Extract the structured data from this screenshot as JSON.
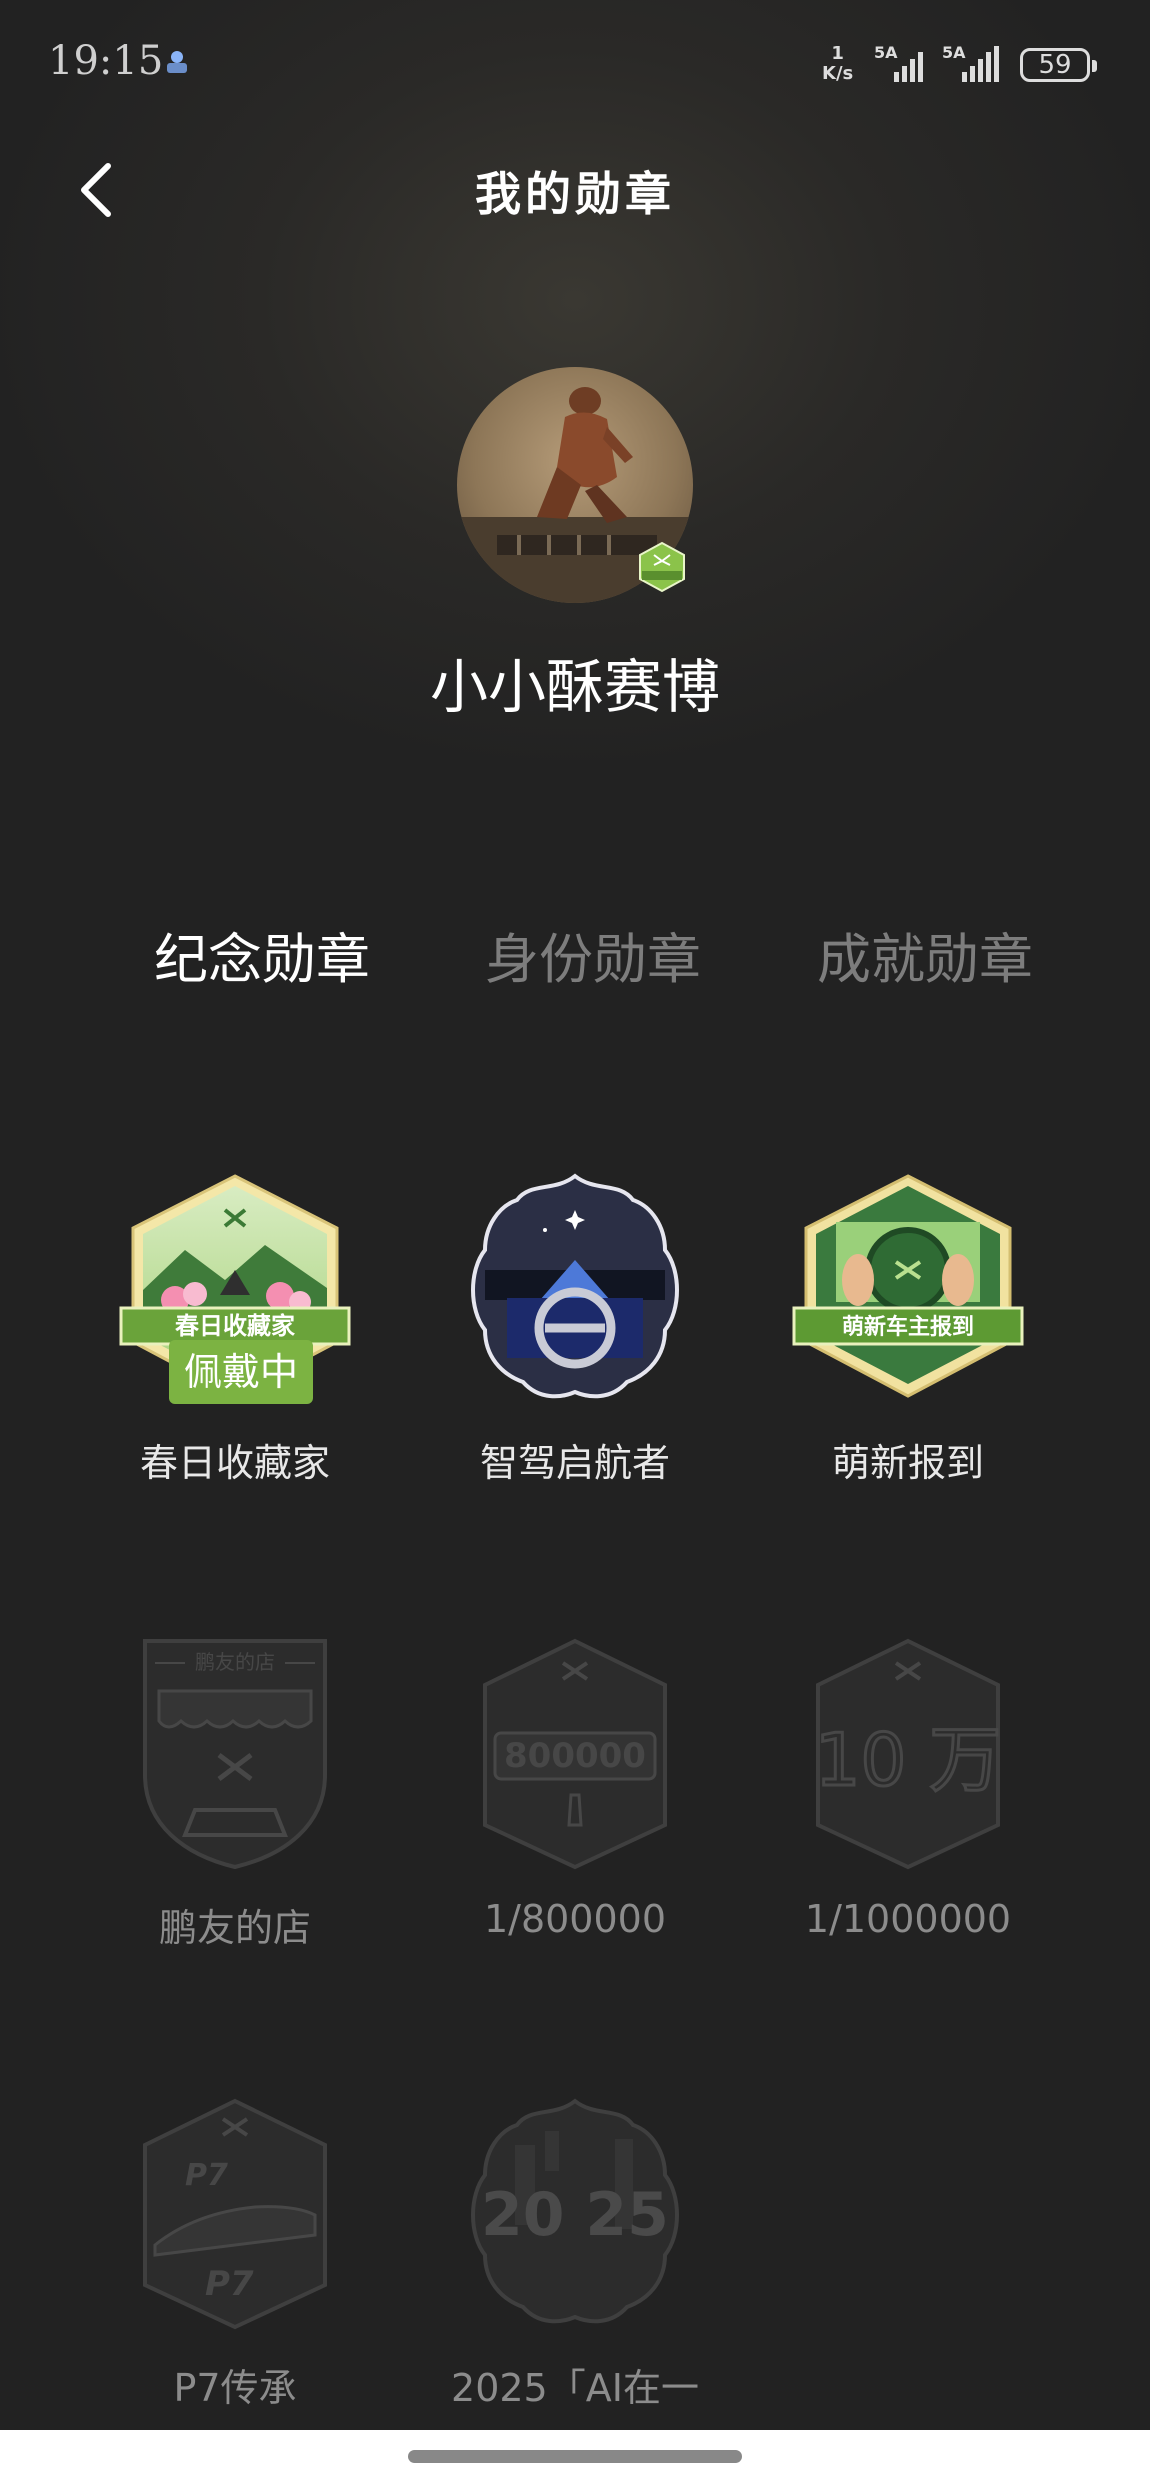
{
  "status_bar": {
    "time": "19:15",
    "net_speed_value": "1",
    "net_speed_unit": "K/s",
    "signal_1_label": "5A",
    "signal_2_label": "5A",
    "battery": "59"
  },
  "header": {
    "title": "我的勋章"
  },
  "profile": {
    "username": "小小酥赛博"
  },
  "tabs": [
    {
      "label": "纪念勋章",
      "active": true
    },
    {
      "label": "身份勋章",
      "active": false
    },
    {
      "label": "成就勋章",
      "active": false
    }
  ],
  "badges": [
    {
      "name": "春日收藏家",
      "ribbon_text": "春日收藏家",
      "wearing_label": "佩戴中",
      "unlocked": true
    },
    {
      "name": "智驾启航者",
      "unlocked": true
    },
    {
      "name": "萌新报到",
      "ribbon_text": "萌新车主报到",
      "unlocked": true
    },
    {
      "name": "鹏友的店",
      "art_text": "鹏友的店",
      "unlocked": false
    },
    {
      "name": "1/800000",
      "art_text": "800000",
      "unlocked": false
    },
    {
      "name": "1/1000000",
      "art_text": "10 万",
      "unlocked": false
    },
    {
      "name": "P7传承",
      "art_text": "P7",
      "unlocked": false
    },
    {
      "name": "2025「AI在一",
      "art_text": "20 25",
      "unlocked": false
    }
  ],
  "colors": {
    "background": "#222222",
    "accent_green": "#7cb342",
    "inactive_tab": "#7d7d7d"
  }
}
